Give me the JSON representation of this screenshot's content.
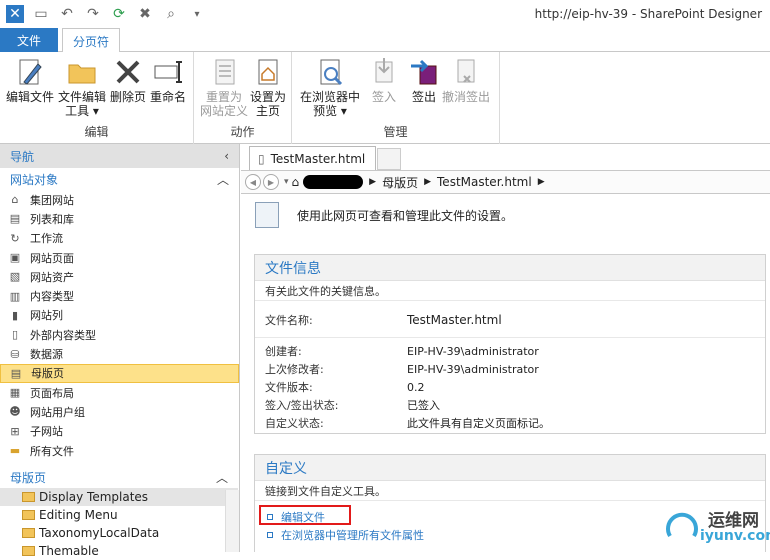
{
  "window": {
    "title": "http://eip-hv-39 - SharePoint Designer"
  },
  "tabs": {
    "file": "文件",
    "active": "分页符"
  },
  "ribbon": {
    "groups": {
      "edit": "编辑",
      "actions": "动作",
      "manage": "管理"
    },
    "buttons": {
      "edit_file": "编辑文件",
      "edit_file_tools_1": "文件编辑",
      "edit_file_tools_2": "工具 ▾",
      "delete_page": "删除页",
      "rename": "重命名",
      "reset_1": "重置为",
      "reset_2": "网站定义",
      "set_home_1": "设置为",
      "set_home_2": "主页",
      "preview_1": "在浏览器中",
      "preview_2": "预览 ▾",
      "check_in": "签入",
      "check_out": "签出",
      "undo_checkout": "撤消签出"
    }
  },
  "nav": {
    "header": "导航",
    "site_objects": "网站对象",
    "items": [
      {
        "label": "集团网站",
        "icon": "home-icon"
      },
      {
        "label": "列表和库",
        "icon": "list-icon"
      },
      {
        "label": "工作流",
        "icon": "workflow-icon"
      },
      {
        "label": "网站页面",
        "icon": "page-icon"
      },
      {
        "label": "网站资产",
        "icon": "asset-icon"
      },
      {
        "label": "内容类型",
        "icon": "content-type-icon"
      },
      {
        "label": "网站列",
        "icon": "column-icon"
      },
      {
        "label": "外部内容类型",
        "icon": "external-icon"
      },
      {
        "label": "数据源",
        "icon": "database-icon"
      },
      {
        "label": "母版页",
        "icon": "master-page-icon"
      },
      {
        "label": "页面布局",
        "icon": "layout-icon"
      },
      {
        "label": "网站用户组",
        "icon": "users-icon"
      },
      {
        "label": "子网站",
        "icon": "subsite-icon"
      },
      {
        "label": "所有文件",
        "icon": "folder-icon"
      }
    ],
    "master_pages_header": "母版页",
    "master_pages": [
      "Display Templates",
      "Editing Menu",
      "TaxonomyLocalData",
      "Themable"
    ]
  },
  "doc": {
    "tab_label": "TestMaster.html",
    "breadcrumb": [
      "母版页",
      "TestMaster.html"
    ],
    "intro": "使用此网页可查看和管理此文件的设置。"
  },
  "file_info": {
    "title": "文件信息",
    "subtitle": "有关此文件的关键信息。",
    "filename_label": "文件名称:",
    "filename_value": "TestMaster.html",
    "rows": [
      {
        "k": "创建者:",
        "v": "EIP-HV-39\\administrator"
      },
      {
        "k": "上次修改者:",
        "v": "EIP-HV-39\\administrator"
      },
      {
        "k": "文件版本:",
        "v": "0.2"
      },
      {
        "k": "签入/签出状态:",
        "v": "已签入"
      },
      {
        "k": "自定义状态:",
        "v": "此文件具有自定义页面标记。"
      }
    ]
  },
  "customize": {
    "title": "自定义",
    "subtitle": "链接到文件自定义工具。",
    "links": [
      "编辑文件",
      "在浏览器中管理所有文件属性"
    ]
  },
  "watermark": {
    "text": "运维网",
    "url": "iyunv.com"
  }
}
